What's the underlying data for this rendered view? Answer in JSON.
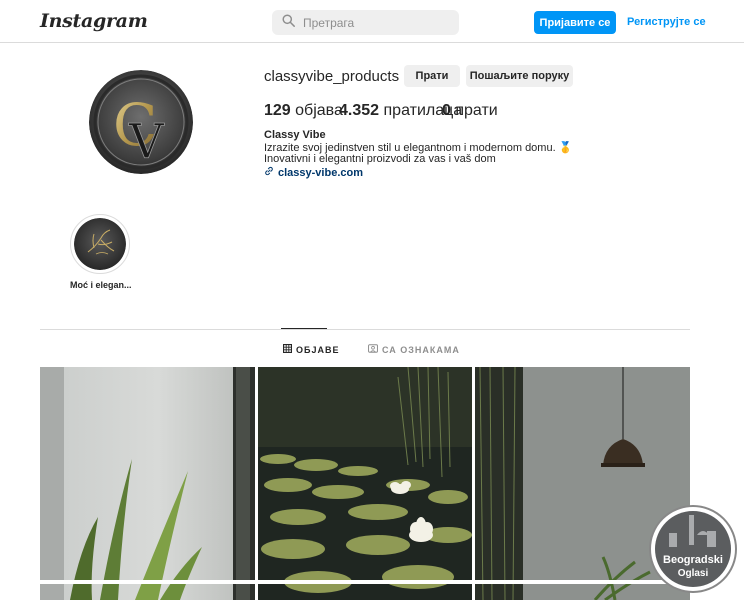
{
  "header": {
    "logo": "Instagram",
    "search_placeholder": "Претрага",
    "login_label": "Пријавите се",
    "signup_label": "Региструјте се"
  },
  "profile": {
    "username": "classyvibe_products",
    "follow_label": "Прати",
    "message_label": "Пошаљите поруку",
    "stats": {
      "posts_count": "129",
      "posts_label": "објава",
      "followers_count": "4.352",
      "followers_label": "пратилаца",
      "following_count": "0",
      "following_label": "прати"
    },
    "bio": {
      "name": "Classy Vibe",
      "line1": "Izrazite svoj jedinstven stil u elegantnom i modernom domu. 🥇",
      "line2": "Inovativni i elegantni proizvodi za vas i vaš dom",
      "link": "classy-vibe.com"
    }
  },
  "highlights": [
    {
      "label": "Moć i elegan..."
    }
  ],
  "tabs": [
    {
      "label": "ОБЈАВЕ",
      "active": true
    },
    {
      "label": "СА ОЗНАКАМА",
      "active": false
    }
  ],
  "watermark": {
    "line1": "Beogradski",
    "line2": "Oglasi"
  },
  "colors": {
    "accent": "#0095f6",
    "link": "#00376b",
    "border": "#dbdbdb"
  }
}
